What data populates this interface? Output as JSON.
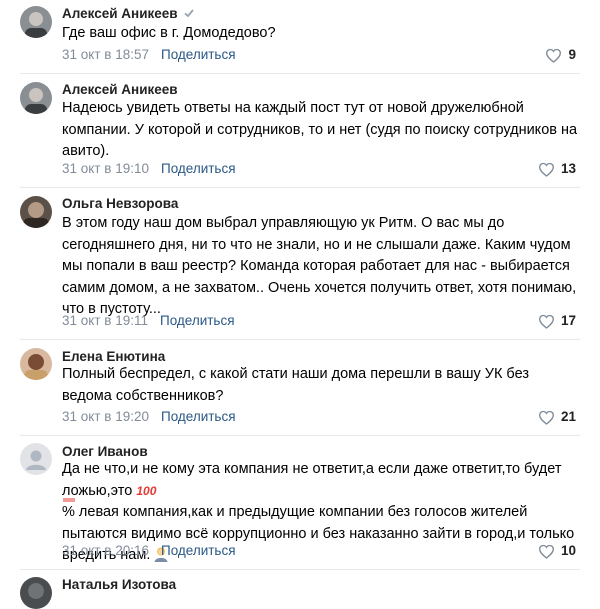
{
  "comments": [
    {
      "author": "Алексей Аникеев",
      "verified": true,
      "text": "Где ваш офис в г. Домодедово?",
      "date": "31 окт в 18:57",
      "share": "Поделиться",
      "likes": "9"
    },
    {
      "author": "Алексей Аникеев",
      "text": "Надеюсь увидеть ответы на каждый пост тут от новой дружелюбной компании. У которой и сотрудников, то и нет (судя по поиску сотрудников на авито).",
      "date": "31 окт в 19:10",
      "share": "Поделиться",
      "likes": "13"
    },
    {
      "author": "Ольга Невзорова",
      "text": "В этом году наш дом выбрал управляющую ук Ритм. О вас мы до сегодняшнего дня, ни то что не знали, но и не слышали даже. Каким чудом мы попали в ваш реестр? Команда которая работает для нас - выбирается самим домом, а не захватом.. Очень хочется получить ответ, хотя понимаю, что в пустоту...",
      "date": "31 окт в 19:11",
      "share": "Поделиться",
      "likes": "17"
    },
    {
      "author": "Елена Енютина",
      "text": "Полный беспредел, с какой стати наши дома перешли в вашу УК без ведома собственников?",
      "date": "31 окт в 19:20",
      "share": "Поделиться",
      "likes": "21"
    },
    {
      "author": "Олег Иванов",
      "text_part1": "Да не что,и не кому эта компания не ответит,а если даже ответит,то будет ложью,это ",
      "emoji": "100",
      "text_part2": "% левая компания,как и предыдущие компании без голосов жителей пытаются видимо всё коррупционно и без наказанно зайти в город,и только вредить нам.",
      "date": "31 окт в 20:16",
      "share": "Поделиться",
      "likes": "10"
    },
    {
      "author": "Наталья Изотова"
    }
  ],
  "colors": {
    "link": "#2a5885",
    "muted": "#818c99",
    "divider": "#e7e8ec"
  }
}
